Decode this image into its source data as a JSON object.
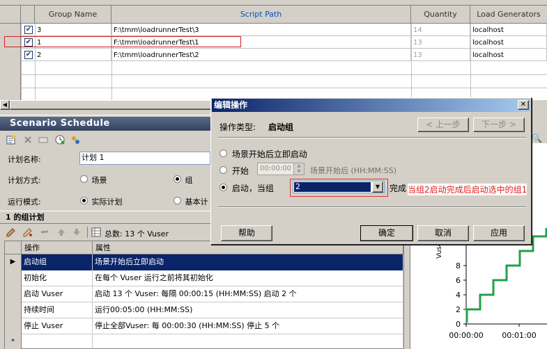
{
  "groups_grid": {
    "headers": {
      "group_name": "Group Name",
      "script_path": "Script Path",
      "quantity": "Quantity",
      "load_generators": "Load Generators"
    },
    "rows": [
      {
        "checked": true,
        "name": "3",
        "script_path": "F:\\tmm\\loadrunnerTest\\3",
        "quantity": "14",
        "load_generator": "localhost"
      },
      {
        "checked": true,
        "name": "1",
        "script_path": "F:\\tmm\\loadrunnerTest\\1",
        "quantity": "13",
        "load_generator": "localhost"
      },
      {
        "checked": true,
        "name": "2",
        "script_path": "F:\\tmm\\loadrunnerTest\\2",
        "quantity": "13",
        "load_generator": "localhost"
      }
    ]
  },
  "schedule": {
    "title": "Scenario Schedule",
    "schedule_name_label": "计划名称:",
    "schedule_name_value": "计划 1",
    "schedule_by_label": "计划方式:",
    "schedule_by_options": [
      "场景",
      "组"
    ],
    "run_mode_label": "运行模式:",
    "run_mode_options": [
      "实际计划",
      "基本计"
    ],
    "group_schedule_title": "1 的组计划",
    "total_label": "总数: 13 个 Vuser",
    "actions_table": {
      "headers": [
        "操作",
        "属性"
      ],
      "rows": [
        {
          "action": "启动组",
          "property": "场景开始后立即启动",
          "selected": true
        },
        {
          "action": "初始化",
          "property": "在每个 Vuser 运行之前将其初始化",
          "selected": false
        },
        {
          "action": "启动 Vuser",
          "property": "启动 13 个 Vuser: 每隔 00:00:15 (HH:MM:SS) 启动 2 个",
          "selected": false
        },
        {
          "action": "持续时间",
          "property": "运行00:05:00 (HH:MM:SS)",
          "selected": false
        },
        {
          "action": "停止 Vuser",
          "property": "停止全部Vuser: 每 00:00:30 (HH:MM:SS) 停止 5 个",
          "selected": false
        },
        {
          "action": "",
          "property": "",
          "selected": false,
          "new_row_marker": "*"
        }
      ]
    }
  },
  "chart": {
    "y_axis_label": "Vuser",
    "y_ticks": [
      "0",
      "2",
      "4",
      "6",
      "8"
    ],
    "x_ticks": [
      "00:00:00",
      "00:01:00"
    ],
    "line_color": "#22a04a"
  },
  "dialog": {
    "title": "编辑操作",
    "close_glyph": "✕",
    "action_type_label": "操作类型:",
    "action_type_value": "启动组",
    "prev_button": "< 上一步",
    "next_button": "下一步 >",
    "option_immediately": "场景开始后立即启动",
    "option_delay_label": "开始",
    "option_delay_value": "00:00:00",
    "option_delay_suffix": "场景开始后 (HH:MM:SS)",
    "option_after_group_label": "启动，当组",
    "option_after_group_value": "2",
    "option_after_group_suffix": "完成",
    "annotation": "当组2启动完成后启动选中的组1",
    "help_button": "帮助",
    "ok_button": "确定",
    "cancel_button": "取消",
    "apply_button": "应用"
  }
}
